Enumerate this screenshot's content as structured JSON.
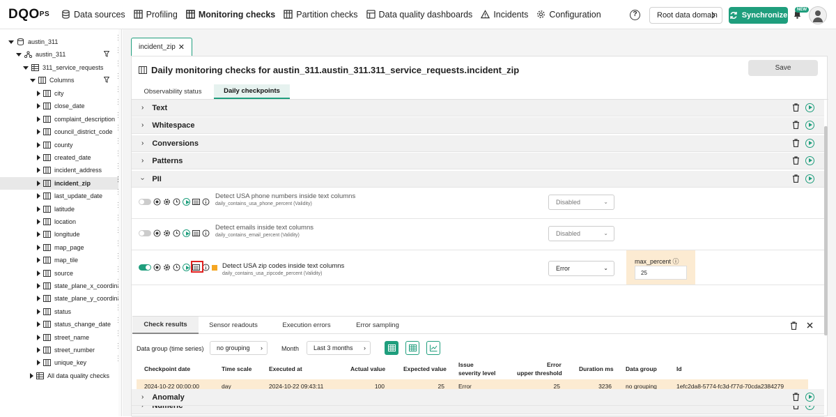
{
  "brand": {
    "logo_main": "DQO",
    "logo_sub": "PS"
  },
  "nav": [
    {
      "label": "Data sources",
      "icon": "database-icon"
    },
    {
      "label": "Profiling",
      "icon": "table-icon"
    },
    {
      "label": "Monitoring checks",
      "icon": "table-icon",
      "active": true
    },
    {
      "label": "Partition checks",
      "icon": "table-icon"
    },
    {
      "label": "Data quality dashboards",
      "icon": "dashboard-icon"
    },
    {
      "label": "Incidents",
      "icon": "warning-icon"
    },
    {
      "label": "Configuration",
      "icon": "gear-icon"
    }
  ],
  "topright": {
    "help": "?",
    "domain": "Root data domain",
    "sync": "Synchronize",
    "new_badge": "NEW"
  },
  "tree": {
    "connection": "austin_311",
    "schema": "austin_311",
    "table": "311_service_requests",
    "columns_label": "Columns",
    "columns": [
      "city",
      "close_date",
      "complaint_description",
      "council_district_code",
      "county",
      "created_date",
      "incident_address",
      "incident_zip",
      "last_update_date",
      "latitude",
      "location",
      "longitude",
      "map_page",
      "map_tile",
      "source",
      "state_plane_x_coordina",
      "state_plane_y_coordina",
      "status",
      "status_change_date",
      "street_name",
      "street_number",
      "unique_key"
    ],
    "selected": "incident_zip",
    "all_checks": "All data quality checks"
  },
  "tab": {
    "label": "incident_zip",
    "close": "✕"
  },
  "panel": {
    "title": "Daily monitoring checks for austin_311.austin_311.311_service_requests.incident_zip",
    "save": "Save",
    "subtabs": [
      "Observability status",
      "Daily checkpoints"
    ]
  },
  "categories_top": [
    "Text",
    "Whitespace",
    "Conversions",
    "Patterns",
    "PII"
  ],
  "categories_bottom": [
    "Numeric",
    "Anomaly"
  ],
  "checks": [
    {
      "name": "Detect USA phone numbers inside text columns",
      "sub": "daily_contains_usa_phone_percent (Validity)",
      "severity": "Disabled",
      "enabled": false
    },
    {
      "name": "Detect emails inside text columns",
      "sub": "daily_contains_email_percent (Validity)",
      "severity": "Disabled",
      "enabled": false
    },
    {
      "name": "Detect USA zip codes inside text columns",
      "sub": "daily_contains_usa_zipcode_percent (Validity)",
      "severity": "Error",
      "enabled": true,
      "param_label": "max_percent",
      "param_value": "25"
    }
  ],
  "results": {
    "tabs": [
      "Check results",
      "Sensor readouts",
      "Execution errors",
      "Error sampling"
    ],
    "data_group_label": "Data group (time series)",
    "data_group_value": "no grouping",
    "month_label": "Month",
    "month_value": "Last 3 months",
    "headers": [
      "Checkpoint date",
      "Time scale",
      "Executed at",
      "Actual value",
      "Expected value",
      "Issue",
      "severity level",
      "Error",
      "upper threshold",
      "Duration ms",
      "Data group",
      "Id"
    ],
    "row": {
      "checkpoint_date": "2024-10-22 00:00:00",
      "time_scale": "day",
      "executed_at": "2024-10-22 09:43:11",
      "actual": "100",
      "expected": "25",
      "severity": "Error",
      "upper": "25",
      "duration": "3236",
      "group": "no grouping",
      "id": "1efc2da8-5774-fc3d-f77d-70cda2384279"
    }
  },
  "colors": {
    "accent": "#1f9e7d",
    "highlight": "#fcebd2",
    "error_orange": "#f5a623"
  }
}
